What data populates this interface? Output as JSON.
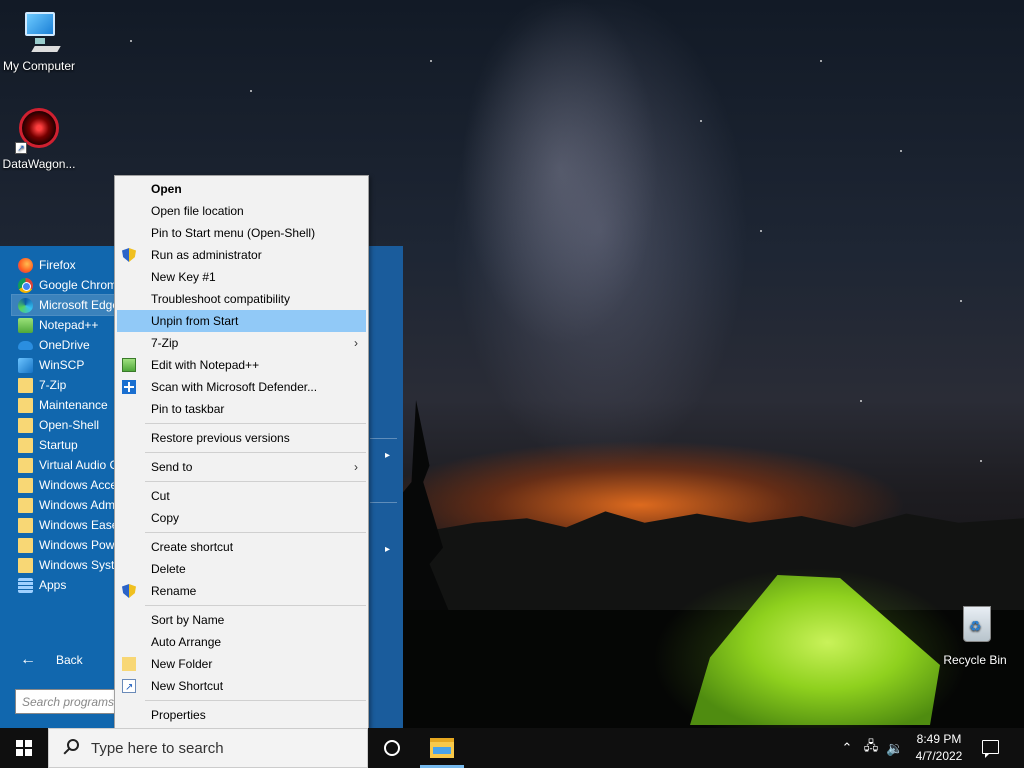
{
  "desktop": {
    "icons": [
      {
        "label": "My Computer",
        "icon": "computer-icon"
      },
      {
        "label": "DataWagon...",
        "icon": "datawagon-shortcut-icon"
      },
      {
        "label": "Recycle Bin",
        "icon": "recycle-bin-icon"
      }
    ]
  },
  "start_menu": {
    "programs": [
      {
        "label": "Firefox",
        "icon": "firefox-icon"
      },
      {
        "label": "Google Chrome",
        "icon": "chrome-icon"
      },
      {
        "label": "Microsoft Edge",
        "icon": "edge-icon"
      },
      {
        "label": "Notepad++",
        "icon": "notepad-plus-plus-icon"
      },
      {
        "label": "OneDrive",
        "icon": "onedrive-icon"
      },
      {
        "label": "WinSCP",
        "icon": "winscp-icon"
      },
      {
        "label": "7-Zip",
        "icon": "folder-icon"
      },
      {
        "label": "Maintenance",
        "icon": "folder-icon"
      },
      {
        "label": "Open-Shell",
        "icon": "folder-icon"
      },
      {
        "label": "Startup",
        "icon": "folder-icon"
      },
      {
        "label": "Virtual Audio Cable",
        "icon": "folder-icon"
      },
      {
        "label": "Windows Accessories",
        "icon": "folder-icon"
      },
      {
        "label": "Windows Administrative Tools",
        "icon": "folder-icon"
      },
      {
        "label": "Windows Ease of Access",
        "icon": "folder-icon"
      },
      {
        "label": "Windows PowerShell",
        "icon": "folder-icon"
      },
      {
        "label": "Windows System",
        "icon": "folder-icon"
      },
      {
        "label": "Apps",
        "icon": "apps-icon"
      }
    ],
    "selected_index": 2,
    "back_label": "Back",
    "search_placeholder": "Search programs and files"
  },
  "context_menu": {
    "groups": [
      [
        {
          "label": "Open",
          "bold": true
        },
        {
          "label": "Open file location"
        },
        {
          "label": "Pin to Start menu (Open-Shell)"
        },
        {
          "label": "Run as administrator",
          "icon": "uac-shield-icon"
        },
        {
          "label": "New Key #1"
        },
        {
          "label": "Troubleshoot compatibility"
        },
        {
          "label": "Unpin from Start",
          "highlighted": true
        },
        {
          "label": "7-Zip",
          "submenu": true
        },
        {
          "label": "Edit with Notepad++",
          "icon": "notepad-plus-plus-icon"
        },
        {
          "label": "Scan with Microsoft Defender...",
          "icon": "defender-icon"
        },
        {
          "label": "Pin to taskbar"
        }
      ],
      [
        {
          "label": "Restore previous versions"
        }
      ],
      [
        {
          "label": "Send to",
          "submenu": true
        }
      ],
      [
        {
          "label": "Cut"
        },
        {
          "label": "Copy"
        }
      ],
      [
        {
          "label": "Create shortcut"
        },
        {
          "label": "Delete"
        },
        {
          "label": "Rename",
          "icon": "uac-shield-icon"
        }
      ],
      [
        {
          "label": "Sort by Name"
        },
        {
          "label": "Auto Arrange"
        },
        {
          "label": "New Folder",
          "icon": "folder-icon"
        },
        {
          "label": "New Shortcut",
          "icon": "shortcut-icon"
        }
      ],
      [
        {
          "label": "Properties"
        }
      ]
    ],
    "submenu_glyph": "›"
  },
  "taskbar": {
    "search_placeholder": "Type here to search",
    "clock_time": "8:49 PM",
    "clock_date": "4/7/2022",
    "tray_icons": [
      "chevron-up-icon",
      "network-icon",
      "volume-icon"
    ],
    "accent_color": "#76b9ed"
  },
  "colors": {
    "start_menu_blue": "#1462a8",
    "context_highlight": "#91c9f7",
    "tent_green": "#8fd11e"
  }
}
